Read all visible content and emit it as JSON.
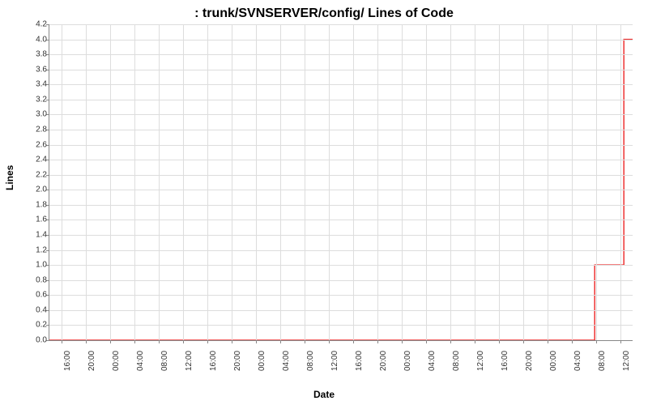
{
  "chart_data": {
    "type": "line",
    "title": ": trunk/SVNSERVER/config/ Lines of Code",
    "xlabel": "Date",
    "ylabel": "Lines",
    "ylim": [
      0,
      4.2
    ],
    "yticks": [
      0.0,
      0.2,
      0.4,
      0.6,
      0.8,
      1.0,
      1.2,
      1.4,
      1.6,
      1.8,
      2.0,
      2.2,
      2.4,
      2.6,
      2.8,
      3.0,
      3.2,
      3.4,
      3.6,
      3.8,
      4.0,
      4.2
    ],
    "xticks": [
      "16:00",
      "20:00",
      "00:00",
      "04:00",
      "08:00",
      "12:00",
      "16:00",
      "20:00",
      "00:00",
      "04:00",
      "08:00",
      "12:00",
      "16:00",
      "20:00",
      "00:00",
      "04:00",
      "08:00",
      "12:00",
      "16:00",
      "20:00",
      "00:00",
      "04:00",
      "08:00",
      "12:00"
    ],
    "series": [
      {
        "name": "Lines of Code",
        "color": "#ee3333",
        "points": [
          {
            "x_frac": 0.0,
            "y": 0
          },
          {
            "x_frac": 0.935,
            "y": 0
          },
          {
            "x_frac": 0.935,
            "y": 1
          },
          {
            "x_frac": 0.985,
            "y": 1
          },
          {
            "x_frac": 0.985,
            "y": 4
          },
          {
            "x_frac": 1.0,
            "y": 4
          }
        ]
      }
    ]
  }
}
